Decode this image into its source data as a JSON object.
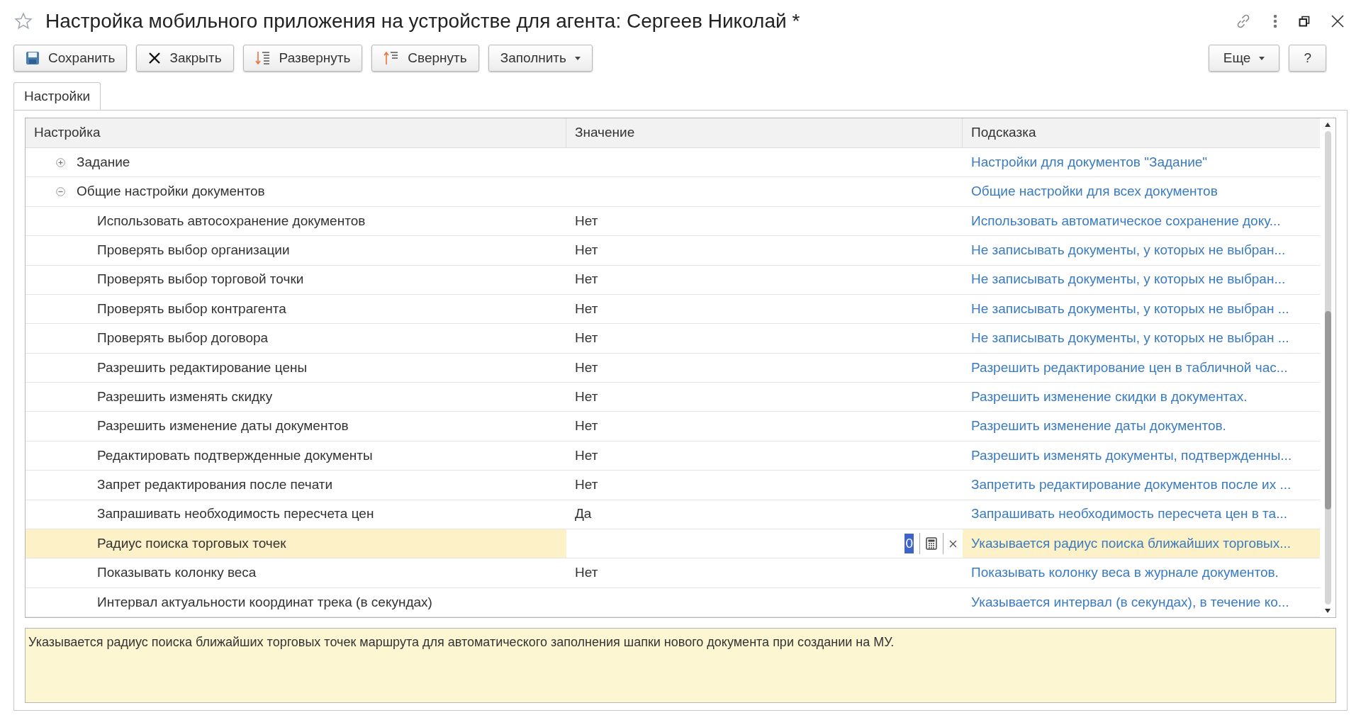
{
  "window": {
    "title": "Настройка мобильного приложения на устройстве для агента: Сергеев Николай *"
  },
  "toolbar": {
    "buttons": [
      {
        "label": "Сохранить",
        "kind": "save",
        "dropdown": false
      },
      {
        "label": "Закрыть",
        "kind": "close",
        "dropdown": false
      },
      {
        "label": "Развернуть",
        "kind": "expand",
        "dropdown": false
      },
      {
        "label": "Свернуть",
        "kind": "collapse",
        "dropdown": false
      },
      {
        "label": "Заполнить",
        "kind": "plain",
        "dropdown": true
      }
    ],
    "right_buttons": [
      {
        "label": "Еще",
        "dropdown": true
      },
      {
        "label": "?",
        "dropdown": false
      }
    ]
  },
  "tabs": [
    {
      "label": "Настройки",
      "selected": true
    }
  ],
  "table": {
    "columns": [
      "Настройка",
      "Значение",
      "Подсказка"
    ],
    "rows": [
      {
        "name": "Задание",
        "hint": "Настройки для документов \"Задание\"",
        "expanded": false,
        "selected": false
      },
      {
        "name": "Общие настройки документов",
        "hint": "Общие настройки для всех документов",
        "expanded": true,
        "selected": false,
        "children": [
          {
            "name": "Использовать автосохранение документов",
            "value": "Нет",
            "hint": "Использовать автоматическое сохранение доку...",
            "selected": false
          },
          {
            "name": "Проверять выбор организации",
            "value": "Нет",
            "hint": "Не записывать документы, у которых не выбран...",
            "selected": false
          },
          {
            "name": "Проверять выбор торговой точки",
            "value": "Нет",
            "hint": "Не записывать документы, у которых не выбран...",
            "selected": false
          },
          {
            "name": "Проверять выбор контрагента",
            "value": "Нет",
            "hint": "Не записывать документы, у которых не выбран ...",
            "selected": false
          },
          {
            "name": "Проверять выбор договора",
            "value": "Нет",
            "hint": "Не записывать документы, у которых не выбран ...",
            "selected": false
          },
          {
            "name": "Разрешить редактирование цены",
            "value": "Нет",
            "hint": "Разрешить редактирование цен в табличной час...",
            "selected": false
          },
          {
            "name": "Разрешить изменять скидку",
            "value": "Нет",
            "hint": "Разрешить изменение скидки в документах.",
            "selected": false
          },
          {
            "name": "Разрешить изменение даты документов",
            "value": "Нет",
            "hint": "Разрешить изменение даты документов.",
            "selected": false
          },
          {
            "name": "Редактировать подтвержденные документы",
            "value": "Нет",
            "hint": "Разрешить изменять документы, подтвержденны...",
            "selected": false
          },
          {
            "name": "Запрет редактирования после печати",
            "value": "Нет",
            "hint": "Запретить редактирование документов после их ...",
            "selected": false
          },
          {
            "name": "Запрашивать необходимость пересчета цен",
            "value": "Да",
            "hint": "Запрашивать необходимость пересчета цен в та...",
            "selected": false
          },
          {
            "name": "Радиус поиска торговых точек",
            "value": "0",
            "hint": "Указывается радиус поиска ближайших торговых...",
            "selected": true
          },
          {
            "name": "Показывать колонку веса",
            "value": "Нет",
            "hint": "Показывать колонку веса в журнале документов.",
            "selected": false
          },
          {
            "name": "Интервал актуальности координат трека (в секундах)",
            "hint": "Указывается интервал (в секундах), в течение ко...",
            "selected": false
          }
        ]
      }
    ]
  },
  "description": "Указывается радиус поиска ближайших торговых точек маршрута для автоматического заполнения шапки нового документа при создании на МУ."
}
